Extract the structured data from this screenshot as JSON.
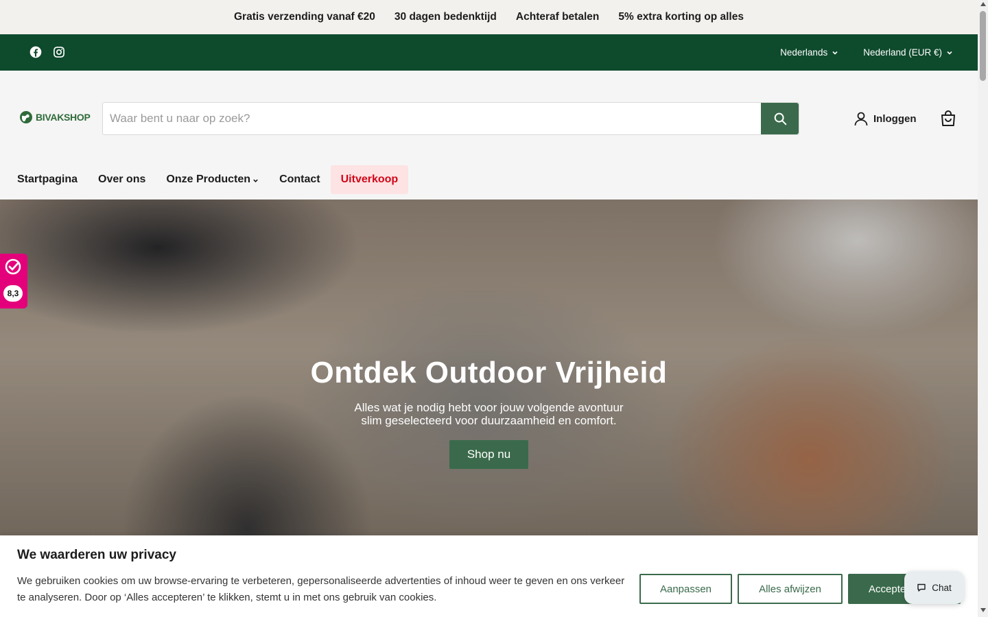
{
  "announcement": {
    "items": [
      "Gratis verzending vanaf €20",
      "30 dagen bedenktijd",
      "Achteraf betalen",
      "5% extra korting op alles"
    ]
  },
  "topbar": {
    "social": [
      "facebook-icon",
      "instagram-icon"
    ],
    "language": "Nederlands",
    "country": "Nederland (EUR €)"
  },
  "header": {
    "logo_text": "BIVAKSHOP",
    "search_placeholder": "Waar bent u naar op zoek?",
    "login_label": "Inloggen"
  },
  "nav": {
    "items": [
      "Startpagina",
      "Over ons",
      "Onze Producten",
      "Contact",
      "Uitverkoop"
    ]
  },
  "hero": {
    "title": "Ontdek Outdoor Vrijheid",
    "subtitle_line1": "Alles wat je nodig hebt voor jouw volgende avontuur",
    "subtitle_line2": "slim geselecteerd voor duurzaamheid en comfort.",
    "cta": "Shop nu"
  },
  "rating": {
    "score": "8,3"
  },
  "cookie": {
    "title": "We waarderen uw privacy",
    "text": "We gebruiken cookies om uw browse-ervaring te verbeteren, gepersonaliseerde advertenties of inhoud weer te geven en ons verkeer te analyseren. Door op ‘Alles accepteren’ te klikken, stemt u in met ons gebruik van cookies.",
    "customize": "Aanpassen",
    "reject": "Alles afwijzen",
    "accept": "Accepteren"
  },
  "chat": {
    "label": "Chat"
  },
  "colors": {
    "brand_green": "#0e4a2c",
    "button_green": "#3a6a4b",
    "sale_red": "#d1061a",
    "rating_pink": "#e3007a"
  }
}
